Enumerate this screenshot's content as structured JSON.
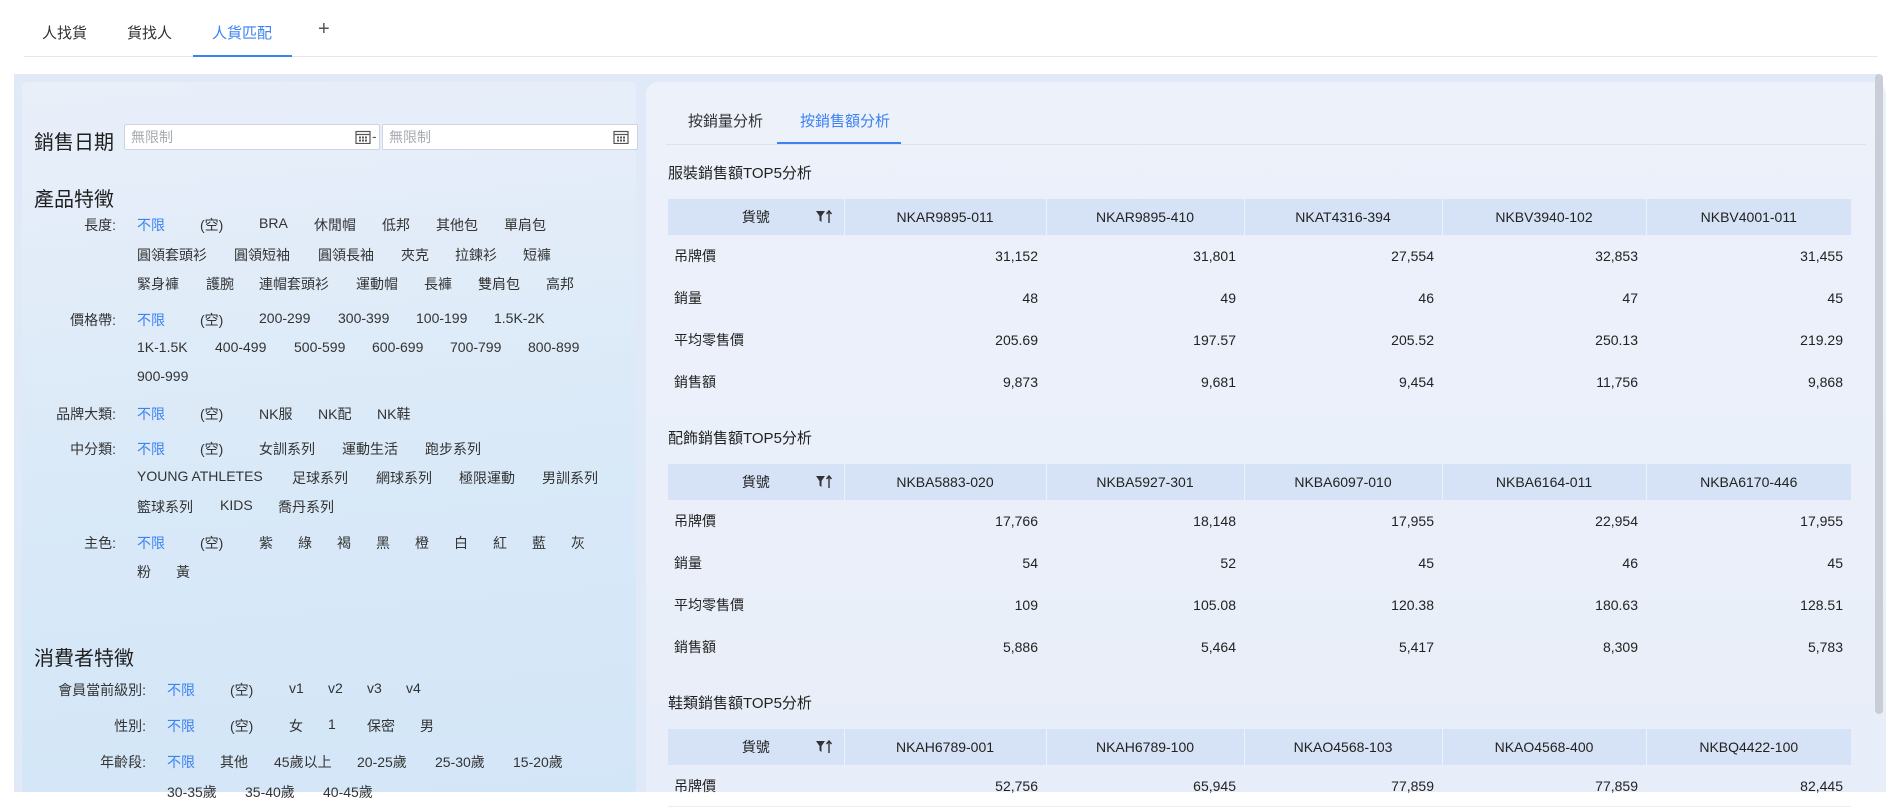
{
  "top_tabs": [
    {
      "label": "人找貨"
    },
    {
      "label": "貨找人"
    },
    {
      "label": "人貨匹配"
    }
  ],
  "left": {
    "sales_date": {
      "label": "銷售日期",
      "start_placeholder": "無限制",
      "end_placeholder": "無限制",
      "separator": "-"
    },
    "product_title": "產品特徵",
    "product_rows": [
      {
        "label": "長度:",
        "options": [
          "不限",
          "(空)",
          "BRA",
          "休閒帽",
          "低邦",
          "其他包",
          "單肩包",
          "圓領套頭衫",
          "圓領短袖",
          "圓領長袖",
          "夾克",
          "拉鍊衫",
          "短褲",
          "緊身褲",
          "護腕",
          "連帽套頭衫",
          "運動帽",
          "長褲",
          "雙肩包",
          "高邦"
        ]
      },
      {
        "label": "價格帶:",
        "options": [
          "不限",
          "(空)",
          "200-299",
          "300-399",
          "100-199",
          "1.5K-2K",
          "1K-1.5K",
          "400-499",
          "500-599",
          "600-699",
          "700-799",
          "800-899",
          "900-999"
        ]
      },
      {
        "label": "品牌大類:",
        "options": [
          "不限",
          "(空)",
          "NK服",
          "NK配",
          "NK鞋"
        ]
      },
      {
        "label": "中分類:",
        "options": [
          "不限",
          "(空)",
          "女訓系列",
          "運動生活",
          "跑步系列",
          "YOUNG ATHLETES",
          "足球系列",
          "網球系列",
          "極限運動",
          "男訓系列",
          "籃球系列",
          "KIDS",
          "喬丹系列"
        ]
      },
      {
        "label": "主色:",
        "options": [
          "不限",
          "(空)",
          "紫",
          "綠",
          "褐",
          "黑",
          "橙",
          "白",
          "紅",
          "藍",
          "灰",
          "粉",
          "黃"
        ]
      }
    ],
    "consumer_title": "消費者特徵",
    "consumer_rows": [
      {
        "label": "會員當前級別:",
        "options": [
          "不限",
          "(空)",
          "v1",
          "v2",
          "v3",
          "v4"
        ]
      },
      {
        "label": "性別:",
        "options": [
          "不限",
          "(空)",
          "女",
          "1",
          "保密",
          "男"
        ]
      },
      {
        "label": "年齡段:",
        "options": [
          "不限",
          "其他",
          "45歲以上",
          "20-25歲",
          "25-30歲",
          "15-20歲",
          "30-35歲",
          "35-40歲",
          "40-45歲"
        ]
      }
    ]
  },
  "right": {
    "tabs": [
      {
        "label": "按銷量分析"
      },
      {
        "label": "按銷售額分析"
      }
    ],
    "tables": [
      {
        "title": "服裝銷售額TOP5分析",
        "header_label": "貨號",
        "columns": [
          "NKAR9895-011",
          "NKAR9895-410",
          "NKAT4316-394",
          "NKBV3940-102",
          "NKBV4001-011"
        ],
        "rows": [
          {
            "label": "吊牌價",
            "values": [
              "31,152",
              "31,801",
              "27,554",
              "32,853",
              "31,455"
            ]
          },
          {
            "label": "銷量",
            "values": [
              "48",
              "49",
              "46",
              "47",
              "45"
            ]
          },
          {
            "label": "平均零售價",
            "values": [
              "205.69",
              "197.57",
              "205.52",
              "250.13",
              "219.29"
            ]
          },
          {
            "label": "銷售額",
            "values": [
              "9,873",
              "9,681",
              "9,454",
              "11,756",
              "9,868"
            ]
          }
        ]
      },
      {
        "title": "配飾銷售額TOP5分析",
        "header_label": "貨號",
        "columns": [
          "NKBA5883-020",
          "NKBA5927-301",
          "NKBA6097-010",
          "NKBA6164-011",
          "NKBA6170-446"
        ],
        "rows": [
          {
            "label": "吊牌價",
            "values": [
              "17,766",
              "18,148",
              "17,955",
              "22,954",
              "17,955"
            ]
          },
          {
            "label": "銷量",
            "values": [
              "54",
              "52",
              "45",
              "46",
              "45"
            ]
          },
          {
            "label": "平均零售價",
            "values": [
              "109",
              "105.08",
              "120.38",
              "180.63",
              "128.51"
            ]
          },
          {
            "label": "銷售額",
            "values": [
              "5,886",
              "5,464",
              "5,417",
              "8,309",
              "5,783"
            ]
          }
        ]
      },
      {
        "title": "鞋類銷售額TOP5分析",
        "header_label": "貨號",
        "columns": [
          "NKAH6789-001",
          "NKAH6789-100",
          "NKAO4568-103",
          "NKAO4568-400",
          "NKBQ4422-100"
        ],
        "rows": [
          {
            "label": "吊牌價",
            "values": [
              "52,756",
              "65,945",
              "77,859",
              "77,859",
              "82,445"
            ]
          }
        ]
      }
    ]
  },
  "colors": {
    "accent": "#3c82f2",
    "header_bg": "#d6e3f6"
  }
}
